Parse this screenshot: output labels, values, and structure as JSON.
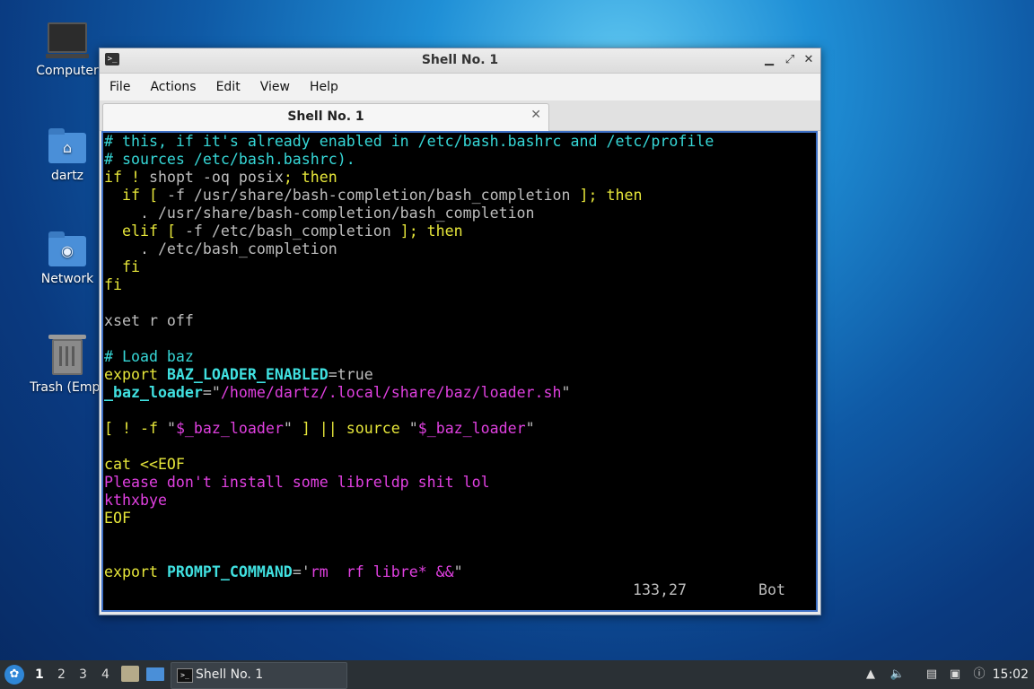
{
  "desktop": {
    "icons": [
      {
        "label": "Computer"
      },
      {
        "label": "dartz"
      },
      {
        "label": "Network"
      },
      {
        "label": "Trash (Empt"
      }
    ]
  },
  "window": {
    "title": "Shell No. 1",
    "controls": {
      "minimize": "▁",
      "maximize": "⤢",
      "close": "✕"
    },
    "menu": [
      "File",
      "Actions",
      "Edit",
      "View",
      "Help"
    ],
    "tab": {
      "label": "Shell No. 1",
      "close": "✕"
    }
  },
  "terminal": {
    "lines": [
      [
        {
          "t": "# this, if it's already enabled in /etc/bash.bashrc and /etc/profile",
          "c": "comment"
        }
      ],
      [
        {
          "t": "# sources /etc/bash.bashrc).",
          "c": "comment"
        }
      ],
      [
        {
          "t": "if",
          "c": "kw"
        },
        {
          "t": " ! ",
          "c": "kw"
        },
        {
          "t": "shopt -oq posix",
          "c": "plain"
        },
        {
          "t": "; then",
          "c": "kw"
        }
      ],
      [
        {
          "t": "  if",
          "c": "kw"
        },
        {
          "t": " [ ",
          "c": "kw"
        },
        {
          "t": "-f /usr/share/bash-completion/bash_completion",
          "c": "plain"
        },
        {
          "t": " ]; then",
          "c": "kw"
        }
      ],
      [
        {
          "t": "    . /usr/share/bash-completion/bash_completion",
          "c": "plain"
        }
      ],
      [
        {
          "t": "  elif",
          "c": "kw"
        },
        {
          "t": " [ ",
          "c": "kw"
        },
        {
          "t": "-f /etc/bash_completion",
          "c": "plain"
        },
        {
          "t": " ]; then",
          "c": "kw"
        }
      ],
      [
        {
          "t": "    . /etc/bash_completion",
          "c": "plain"
        }
      ],
      [
        {
          "t": "  fi",
          "c": "kw"
        }
      ],
      [
        {
          "t": "fi",
          "c": "kw"
        }
      ],
      [
        {
          "t": "",
          "c": "plain"
        }
      ],
      [
        {
          "t": "xset r off",
          "c": "plain"
        }
      ],
      [
        {
          "t": "",
          "c": "plain"
        }
      ],
      [
        {
          "t": "# Load baz",
          "c": "comment"
        }
      ],
      [
        {
          "t": "export ",
          "c": "kw"
        },
        {
          "t": "BAZ_LOADER_ENABLED",
          "c": "var"
        },
        {
          "t": "=true",
          "c": "plain"
        }
      ],
      [
        {
          "t": "_baz_loader",
          "c": "var"
        },
        {
          "t": "=\"",
          "c": "plain"
        },
        {
          "t": "/home/dartz/.local/share/baz/loader.sh",
          "c": "str"
        },
        {
          "t": "\"",
          "c": "plain"
        }
      ],
      [
        {
          "t": "",
          "c": "plain"
        }
      ],
      [
        {
          "t": "[ ! -f ",
          "c": "kw"
        },
        {
          "t": "\"",
          "c": "plain"
        },
        {
          "t": "$_baz_loader",
          "c": "str"
        },
        {
          "t": "\"",
          "c": "plain"
        },
        {
          "t": " ] || ",
          "c": "kw"
        },
        {
          "t": "source ",
          "c": "kw"
        },
        {
          "t": "\"",
          "c": "plain"
        },
        {
          "t": "$_baz_loader",
          "c": "str"
        },
        {
          "t": "\"",
          "c": "plain"
        }
      ],
      [
        {
          "t": "",
          "c": "plain"
        }
      ],
      [
        {
          "t": "cat <<EOF",
          "c": "kw"
        }
      ],
      [
        {
          "t": "Please don't install some libreldp shit lol",
          "c": "str"
        }
      ],
      [
        {
          "t": "kthxbye",
          "c": "str"
        }
      ],
      [
        {
          "t": "EOF",
          "c": "kw"
        }
      ],
      [
        {
          "t": "",
          "c": "plain"
        }
      ],
      [
        {
          "t": "",
          "c": "plain"
        }
      ],
      [
        {
          "t": "export ",
          "c": "kw"
        },
        {
          "t": "PROMPT_COMMAND",
          "c": "var"
        },
        {
          "t": "='",
          "c": "plain"
        },
        {
          "t": "rm ",
          "c": "str"
        },
        {
          "t": "-",
          "c": "cursor"
        },
        {
          "t": "rf libre* &&",
          "c": "str"
        },
        {
          "t": "\"",
          "c": "plain"
        }
      ]
    ],
    "status_position": "133,27",
    "status_scroll": "Bot"
  },
  "taskbar": {
    "workspaces": [
      "1",
      "2",
      "3",
      "4"
    ],
    "active_workspace": "1",
    "task_label": "Shell No. 1",
    "clock": "15:02"
  },
  "colors": {
    "comment": "#36d7d7",
    "keyword": "#e6e63a",
    "string": "#e040e0",
    "variable": "#40e0e0",
    "plain": "#bdbdbd",
    "terminal_bg": "#000000",
    "terminal_border": "#3d6fc4"
  }
}
